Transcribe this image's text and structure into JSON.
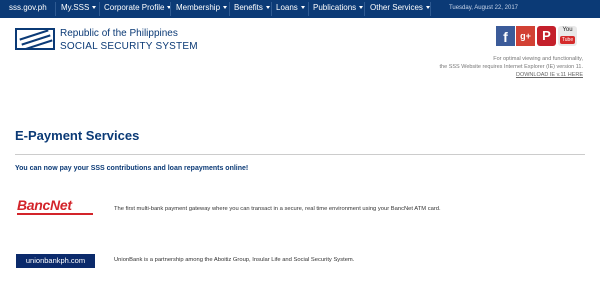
{
  "nav": {
    "site": "sss.gov.ph",
    "items": [
      {
        "label": "My.SSS",
        "dropdown": true
      },
      {
        "label": "Corporate Profile",
        "dropdown": true
      },
      {
        "label": "Membership",
        "dropdown": true
      },
      {
        "label": "Benefits",
        "dropdown": true
      },
      {
        "label": "Loans",
        "dropdown": true
      },
      {
        "label": "Publications",
        "dropdown": true
      },
      {
        "label": "Other Services",
        "dropdown": true
      }
    ],
    "date": "Tuesday, August 22, 2017"
  },
  "header": {
    "brand_line1": "Republic of the Philippines",
    "brand_line2": "SOCIAL SECURITY SYSTEM",
    "social": [
      {
        "name": "facebook-icon",
        "glyph": "f"
      },
      {
        "name": "google-plus-icon",
        "glyph": "g+"
      },
      {
        "name": "pinterest-icon",
        "glyph": "P"
      },
      {
        "name": "youtube-icon",
        "glyph_top": "You",
        "glyph_bottom": "Tube"
      }
    ],
    "browser_note_line1": "For optimal viewing and functionality,",
    "browser_note_line2": "the SSS Website requires Internet Explorer (IE) version 11.",
    "download_link": "DOWNLOAD IE v.11 HERE"
  },
  "main": {
    "title": "E-Payment Services",
    "lead": "You can now pay your SSS contributions and loan repayments online!",
    "partners": [
      {
        "logo_text": "BancNet",
        "description": "The first multi-bank payment gateway where you can transact in a secure, real time environment using your BancNet ATM card."
      },
      {
        "logo_text": "unionbankph.com",
        "description": "UnionBank is a partnership among the Aboitiz Group, Insular Life and Social Security System."
      }
    ]
  },
  "colors": {
    "nav_bg": "#0b3a76",
    "brand_blue": "#0b3a76",
    "bancnet_red": "#d3242a",
    "unionbank_navy": "#0b2a6b"
  }
}
